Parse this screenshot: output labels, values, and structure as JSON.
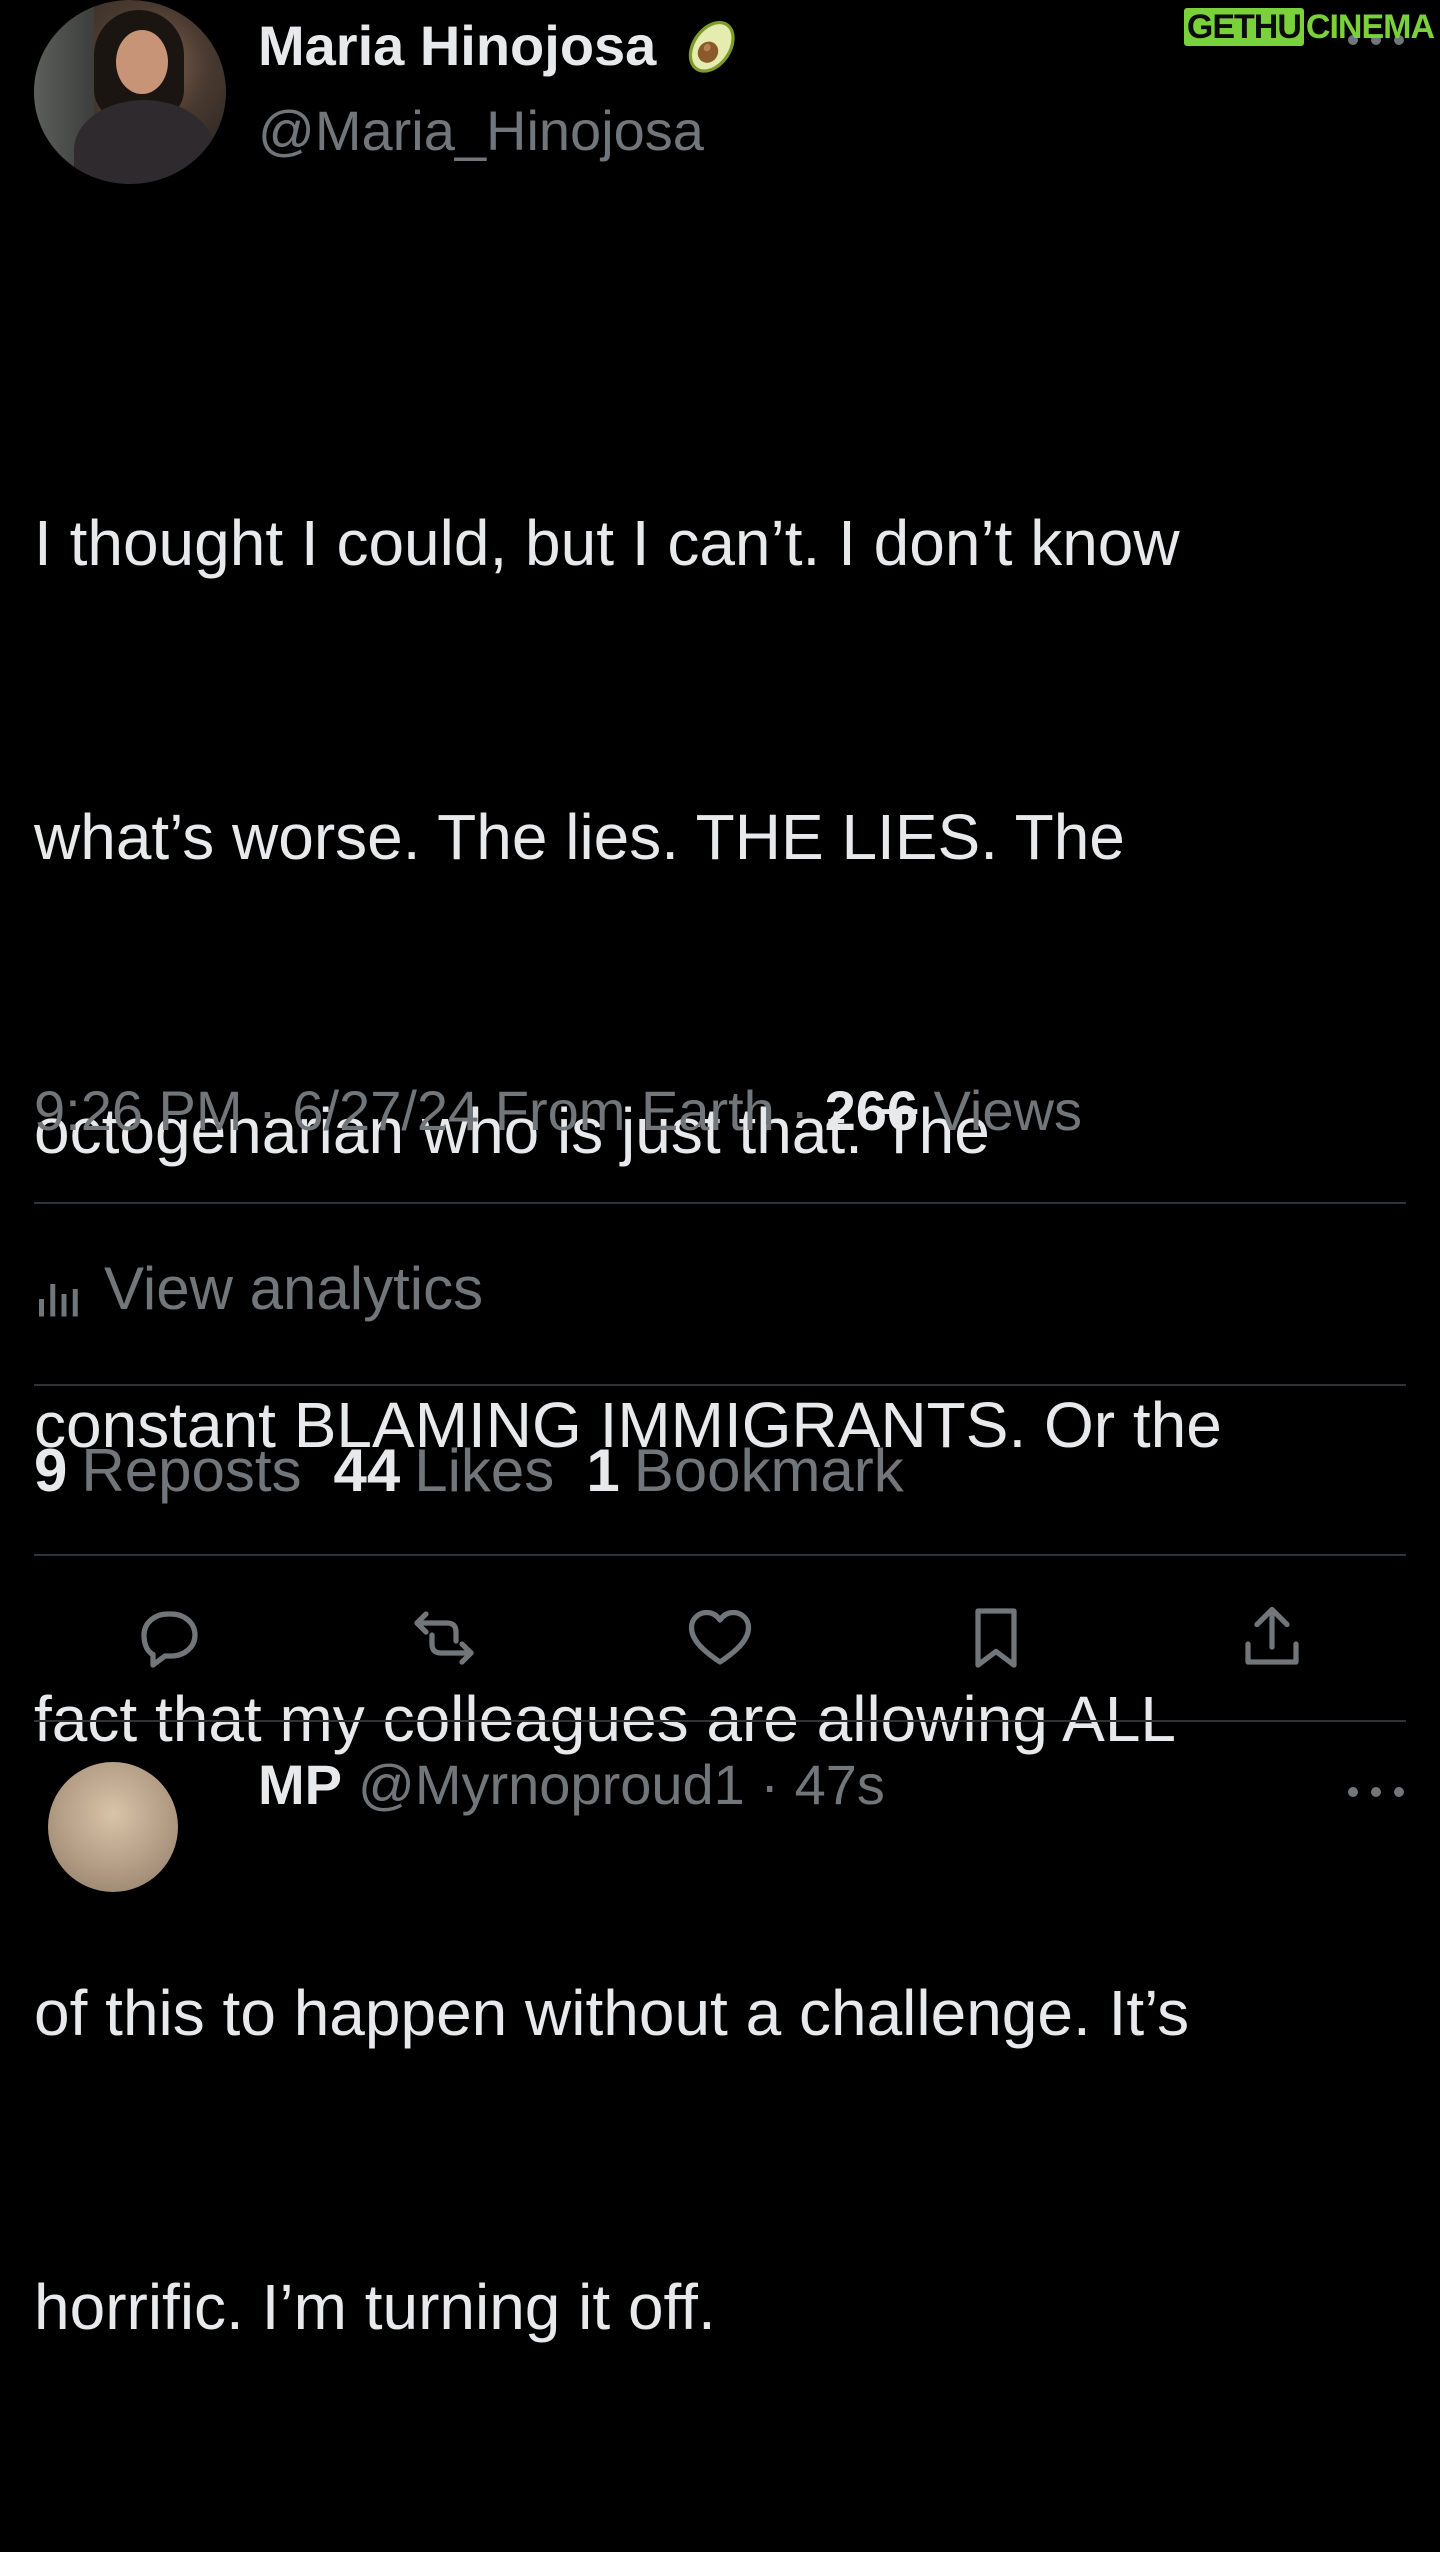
{
  "author": {
    "display_name": "Maria Hinojosa",
    "handle": "@Maria_Hinojosa",
    "badge_icon": "avocado-emoji"
  },
  "watermark": {
    "part_a": "GETHU",
    "part_b": "CINEMA"
  },
  "tweet": {
    "text_lines": [
      "I thought I could, but I can’t. I don’t know",
      "what’s worse. The lies. THE LIES. The",
      "octogenarian who is just that. The",
      "constant BLAMING IMMIGRANTS. Or the",
      "fact that my colleagues are allowing ALL",
      "of this to happen without a challenge. It’s",
      "horrific. I’m turning it off."
    ],
    "time": "9:26 PM",
    "separator": "·",
    "date": "6/27/24",
    "source": "From Earth",
    "views_count": "266",
    "views_label": "Views"
  },
  "analytics": {
    "label": "View analytics"
  },
  "stats": [
    {
      "count": "9",
      "label": "Reposts"
    },
    {
      "count": "44",
      "label": "Likes"
    },
    {
      "count": "1",
      "label": "Bookmark"
    }
  ],
  "actions": [
    "reply",
    "repost",
    "like",
    "bookmark",
    "share"
  ],
  "reply_preview": {
    "name": "MP",
    "handle_and_time": "@Myrnoproud1 · 47s"
  },
  "colors": {
    "background": "#000000",
    "primary_text": "#e7e9ea",
    "secondary_text": "#71767b",
    "divider": "#2f3336",
    "watermark_green": "#7ad13a"
  }
}
